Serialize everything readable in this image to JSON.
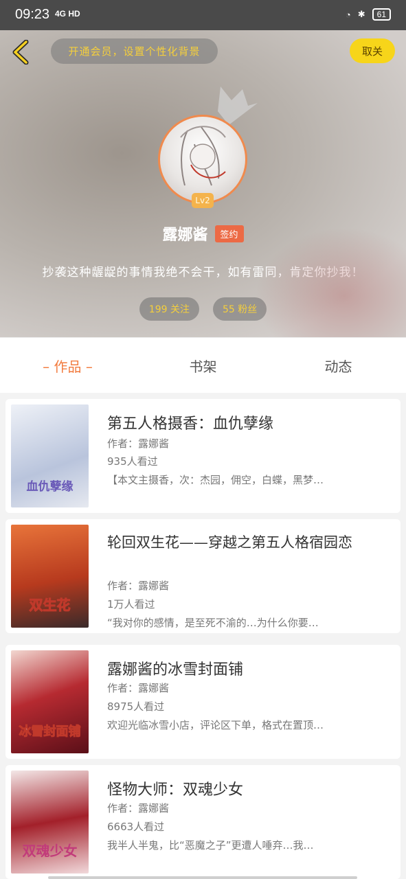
{
  "status_bar": {
    "time": "09:23",
    "network": "4G HD",
    "battery": "61"
  },
  "header": {
    "vip_label": "开通会员，设置个性化背景",
    "cancel_follow_label": "取关",
    "level": "Lv2",
    "name": "露娜酱",
    "sign_badge": "签约",
    "bio": "抄袭这种龌龊的事情我绝不会干，如有雷同，肯定你抄我！",
    "following": "199 关注",
    "fans": "55 粉丝"
  },
  "tabs": [
    {
      "label": "– 作品 –",
      "active": true
    },
    {
      "label": "书架",
      "active": false
    },
    {
      "label": "动态",
      "active": false
    }
  ],
  "books": [
    {
      "title": "第五人格摄香：血仇孽缘",
      "author": "作者：露娜酱",
      "views": "935人看过",
      "desc": "【本文主摄香，次：杰园，佣空，白蝶，黑梦…",
      "cover_text": "血仇孽缘",
      "cover_color": "#cdd6e8"
    },
    {
      "title": "轮回双生花——穿越之第五人格宿园恋",
      "author": "作者：露娜酱",
      "views": "1万人看过",
      "desc": "“我对你的感情，是至死不渝的…为什么你要…",
      "cover_text": "双生花",
      "cover_color": "#d0562b"
    },
    {
      "title": "露娜酱的冰雪封面铺",
      "author": "作者：露娜酱",
      "views": "8975人看过",
      "desc": "欢迎光临冰雪小店，评论区下单，格式在置顶…",
      "cover_text": "冰雪封面铺",
      "cover_color": "#a8262d"
    },
    {
      "title": "怪物大师：双魂少女",
      "author": "作者：露娜酱",
      "views": "6663人看过",
      "desc": "我半人半鬼，比“恶魔之子”更遭人唾弃…我…",
      "cover_text": "双魂少女",
      "cover_color": "#9c1a22"
    }
  ]
}
